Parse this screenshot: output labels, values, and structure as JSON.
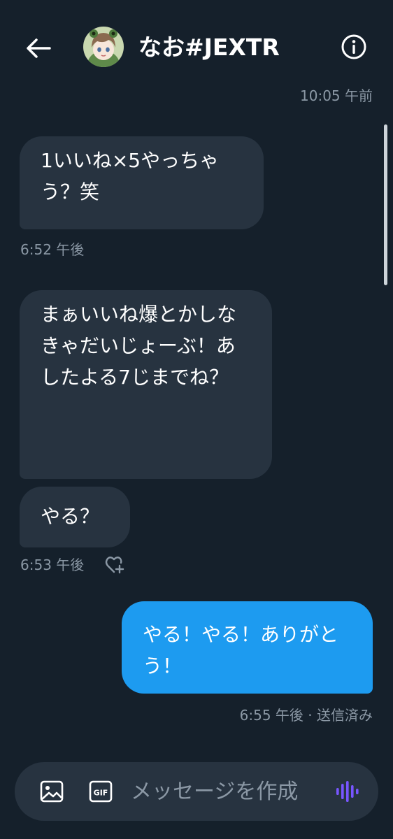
{
  "header": {
    "back_icon": "arrow-left-icon",
    "contact_name": "なお#JEXTR",
    "info_icon": "info-circle-icon"
  },
  "conversation": {
    "top_timestamp": "10:05 午前",
    "messages": [
      {
        "direction": "incoming",
        "text": "1いいね×5やっちゃう？笑",
        "timestamp": "6:52 午後"
      },
      {
        "direction": "incoming",
        "text": "まぁいいね爆とかしなきゃだいじょーぶ！あしたよる7じまでね？"
      },
      {
        "direction": "incoming",
        "text": "やる？",
        "timestamp": "6:53 午後",
        "reaction_icon": "heart-plus-icon"
      },
      {
        "direction": "outgoing",
        "text": "やる！やる！ありがとう！",
        "timestamp": "6:55 午後 · 送信済み"
      }
    ]
  },
  "composer": {
    "image_icon": "image-icon",
    "gif_label": "GIF",
    "placeholder": "メッセージを作成",
    "voice_icon": "voice-wave-icon"
  },
  "colors": {
    "background": "#15202b",
    "incoming_bubble": "#273340",
    "outgoing_bubble": "#1d9bf0",
    "muted_text": "#8b98a5",
    "voice_accent": "#7856ff"
  }
}
